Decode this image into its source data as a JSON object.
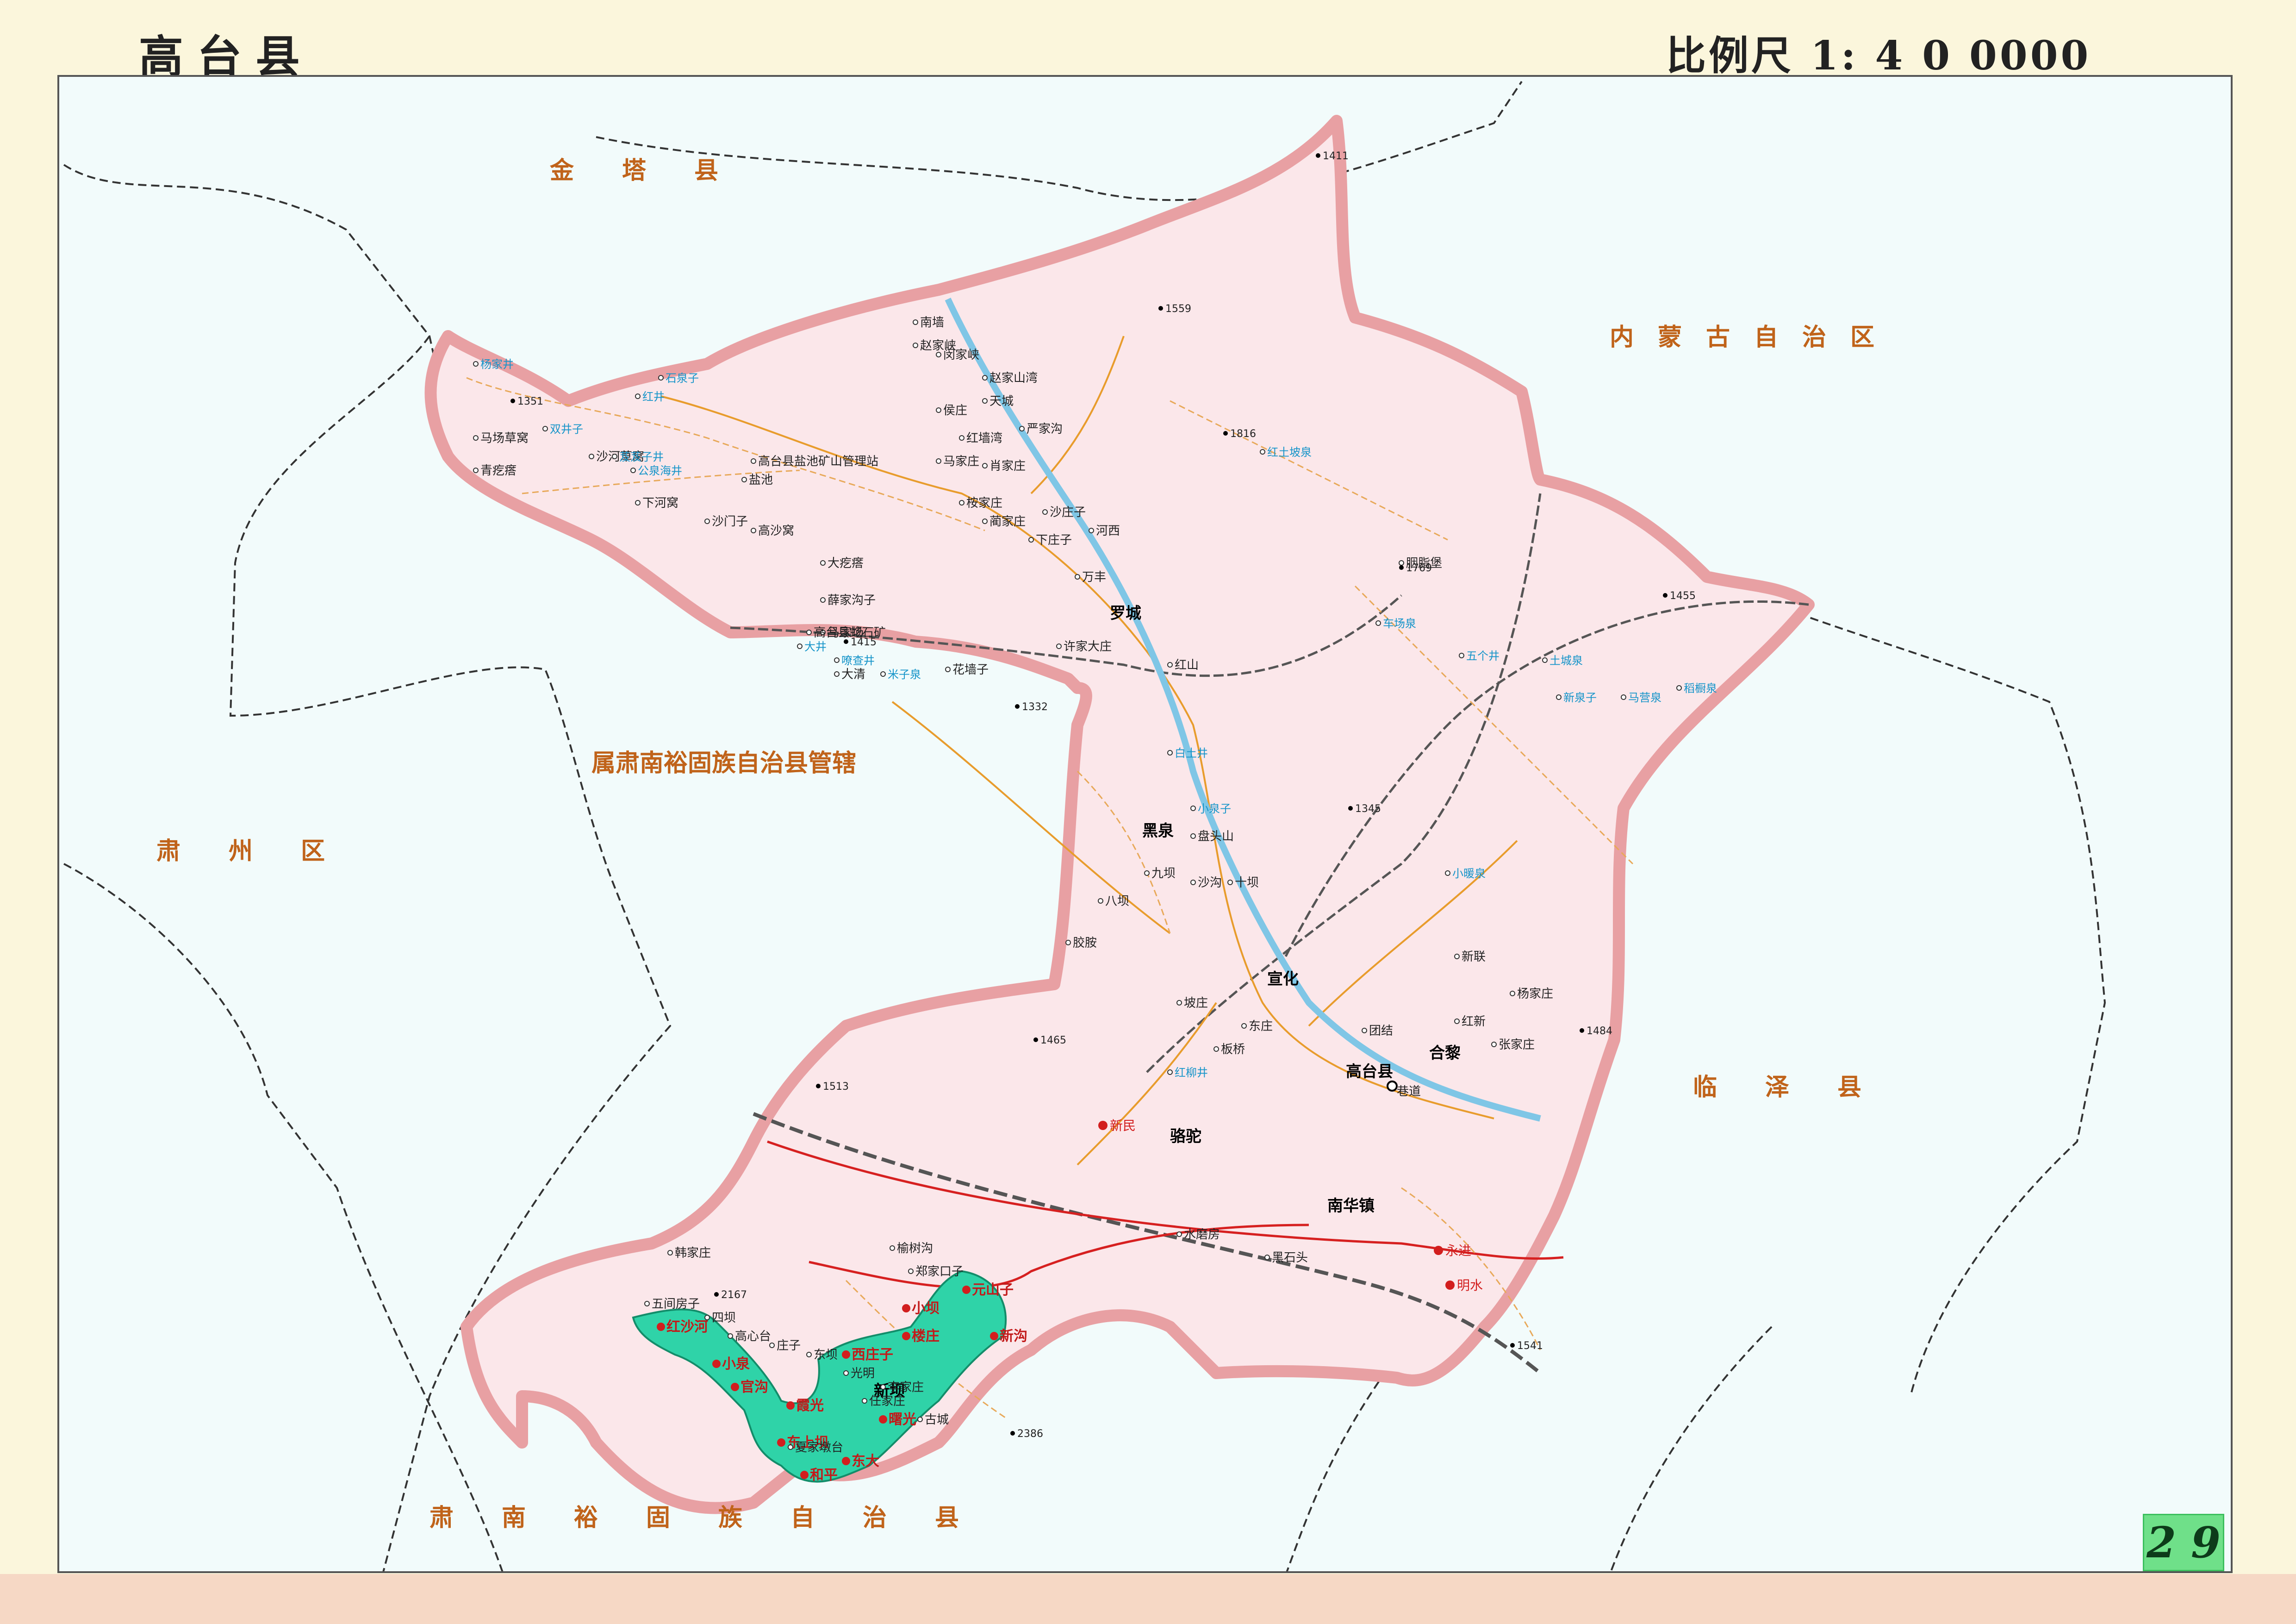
{
  "header": {
    "title": "高台县",
    "scale": "比例尺 1: 4 0 0000"
  },
  "page_number": "2 9",
  "neighbors": {
    "north": "金　　塔　　县",
    "northeast": "内　蒙　古　自　治　区",
    "west_admin": "属肃南裕固族自治县管辖",
    "west": "肃　　州　　区",
    "east": "临　　泽　　县",
    "south": "肃　　南　　裕　　固　　族　　自　　治　　县"
  },
  "colors": {
    "county_fill": "#fbe7ea",
    "county_border": "#e8a0a3",
    "zone_fill": "#2fd3a8",
    "road": "#e89c2c",
    "railway": "#555555",
    "highway_red": "#d62020",
    "river": "#7fc6e6"
  },
  "places": {
    "county_seat": "高台县",
    "county_seat_sub": "巷道",
    "major": [
      "罗城",
      "黑泉",
      "宣化",
      "合黎",
      "骆驼",
      "南华镇",
      "新坝"
    ],
    "red": [
      "新民",
      "永进",
      "明水"
    ],
    "towns": [
      "杨家井",
      "石泉子",
      "红井",
      "马场草窝",
      "双井子",
      "青疙瘩",
      "沙河草窝",
      "高台县盐池矿山管理站",
      "盐池",
      "下河窝",
      "沙门子",
      "高沙窝",
      "大疙瘩",
      "薛家沟子",
      "马家场",
      "大井",
      "南墙",
      "赵家峡",
      "闵家峡",
      "赵家山湾",
      "天城",
      "侯庄",
      "严家沟",
      "红墙湾",
      "马家庄",
      "肖家庄",
      "桉家庄",
      "蔺家庄",
      "沙庄子",
      "河西",
      "下庄子",
      "万丰",
      "许家大庄",
      "红山",
      "花墙子",
      "胭脂堡",
      "白土井",
      "小泉子",
      "盘头山",
      "沙沟",
      "十坝",
      "九坝",
      "八坝",
      "胶胺",
      "坡庄",
      "板桥",
      "红柳井",
      "东庄",
      "团结",
      "红新",
      "新联",
      "杨家庄",
      "张家庄",
      "榆树沟",
      "郑家口子",
      "韩家庄",
      "五间房子",
      "四坝",
      "高心台",
      "庄子",
      "东坝",
      "光明",
      "李家庄",
      "任家庄",
      "古城",
      "夏家墩台",
      "小暖泉",
      "黑石头",
      "水磨房",
      "高台县蛇石矿",
      "稻橱泉",
      "马营泉",
      "新泉子",
      "土城泉",
      "五个井",
      "车场泉",
      "红土坡泉",
      "芨芨子井",
      "公泉海井",
      "嘹查井",
      "大清",
      "米子泉"
    ],
    "elevations": [
      "1351",
      "1415",
      "1332",
      "1559",
      "1816",
      "1769",
      "1345",
      "1465",
      "1513",
      "1484",
      "2167",
      "2386",
      "1541",
      "1455",
      "1411"
    ]
  },
  "zone_towns": [
    "红沙河",
    "小泉",
    "官沟",
    "霞光",
    "东上坝",
    "和平",
    "东大",
    "曙光",
    "西庄子",
    "楼庄",
    "小坝",
    "元山子",
    "新沟"
  ]
}
